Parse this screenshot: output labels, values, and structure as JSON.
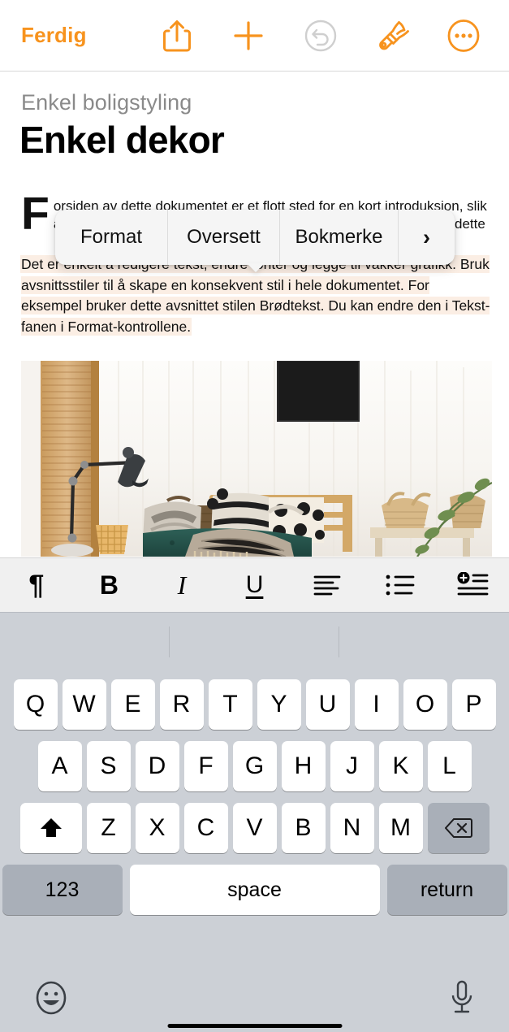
{
  "toolbar": {
    "done_label": "Ferdig",
    "accent_color": "#f7931e",
    "disabled_color": "#c9c9c9",
    "icons": [
      {
        "name": "share-icon",
        "label": "Del"
      },
      {
        "name": "insert-plus-icon",
        "label": "Sett inn"
      },
      {
        "name": "undo-icon",
        "label": "Angre",
        "state": "disabled"
      },
      {
        "name": "format-brush-icon",
        "label": "Format"
      },
      {
        "name": "more-ellipsis-icon",
        "label": "Mer"
      }
    ]
  },
  "document": {
    "eyebrow": "Enkel boligstyling",
    "title": "Enkel dekor",
    "dropcap": "F",
    "intro_visible_left": "o\np\nd",
    "intro_visible_right": "e dette",
    "body_paragraph": "Det er enkelt å redigere tekst, endre fonter og legge til vakker grafikk. Bruk avsnittsstiler til å skape en konsekvent stil i hele dokumentet. For eksempel bruker dette avsnittet stilen Brødtekst. Du kan endre den i Tekst-fanen i Format-kontrollene.",
    "selection_highlight_color": "#fbeee4",
    "image_alt": "Stue med trelameller, svart lampe, putet benk og kurver"
  },
  "context_menu": {
    "items": [
      {
        "label": "Format",
        "name": "menu-item-format"
      },
      {
        "label": "Oversett",
        "name": "menu-item-oversett"
      },
      {
        "label": "Bokmerke",
        "name": "menu-item-bokmerke"
      },
      {
        "label": "›",
        "name": "menu-item-next"
      }
    ]
  },
  "format_bar": {
    "buttons": [
      {
        "name": "paragraph-style-icon",
        "glyph": "¶",
        "label": "Avsnittsstil"
      },
      {
        "name": "bold-icon",
        "glyph": "B",
        "label": "Halvfet"
      },
      {
        "name": "italic-icon",
        "glyph": "I",
        "label": "Kursiv"
      },
      {
        "name": "underline-icon",
        "glyph": "U",
        "label": "Understreket"
      },
      {
        "name": "align-left-icon",
        "glyph": "",
        "label": "Venstrejuster"
      },
      {
        "name": "bullet-list-icon",
        "glyph": "",
        "label": "Punktliste"
      },
      {
        "name": "insert-list-item-icon",
        "glyph": "",
        "label": "Legg til punkt"
      }
    ]
  },
  "keyboard": {
    "row1": [
      "Q",
      "W",
      "E",
      "R",
      "T",
      "Y",
      "U",
      "I",
      "O",
      "P"
    ],
    "row2": [
      "A",
      "S",
      "D",
      "F",
      "G",
      "H",
      "J",
      "K",
      "L"
    ],
    "row3": [
      "Z",
      "X",
      "C",
      "V",
      "B",
      "N",
      "M"
    ],
    "shift_label": "shift",
    "delete_label": "delete",
    "numbers_label": "123",
    "space_label": "space",
    "return_label": "return",
    "emoji_label": "emoji",
    "dictation_label": "dictation",
    "background_color": "#ccd0d6",
    "key_color": "#ffffff",
    "modifier_key_color": "#a9afb8"
  }
}
